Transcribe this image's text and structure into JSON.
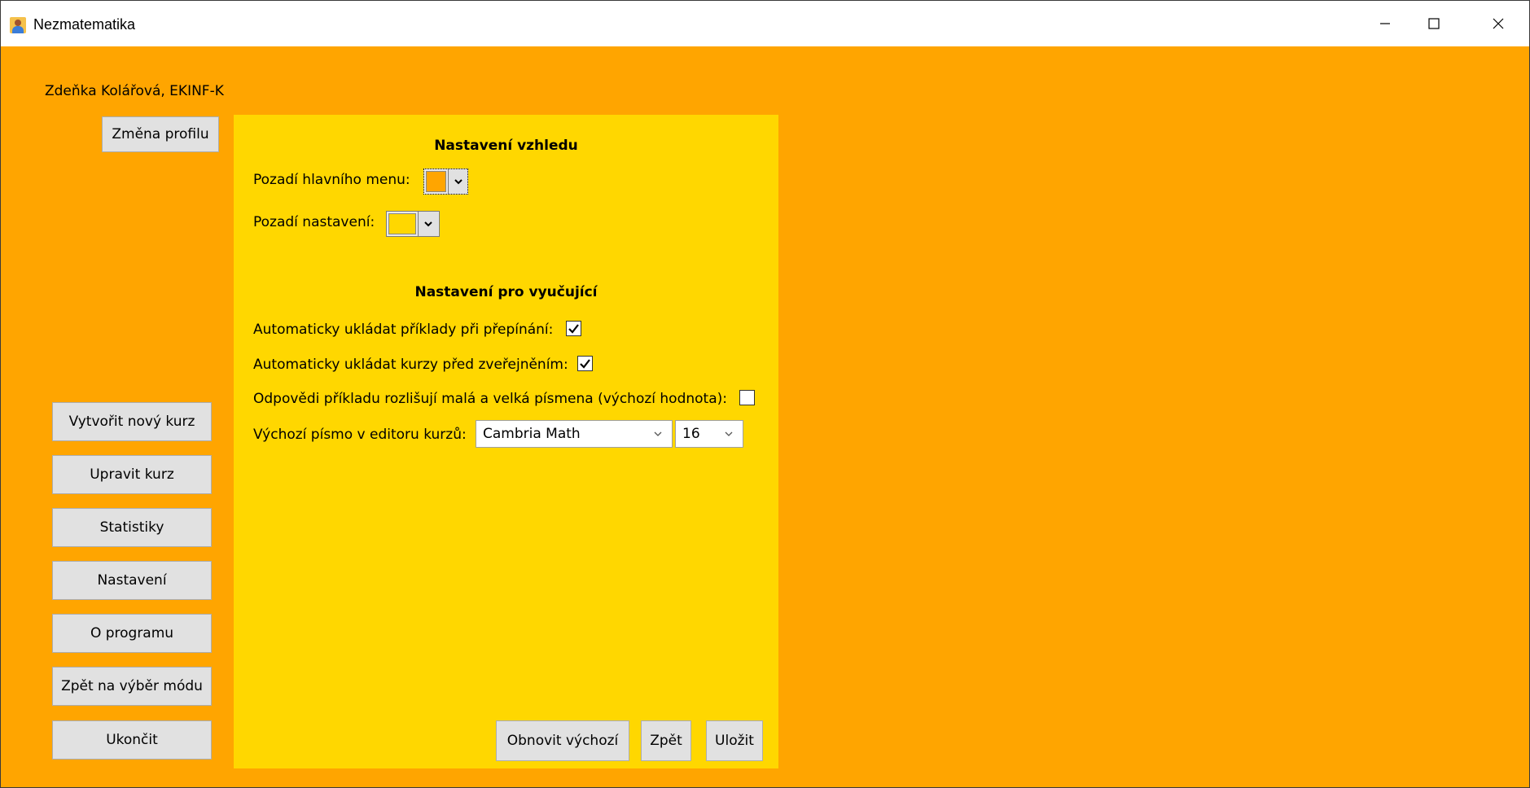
{
  "window": {
    "title": "Nezmatematika"
  },
  "user": {
    "label": "Zdeňka Kolářová, EKINF-K"
  },
  "sidebar": {
    "profile_button": "Změna profilu",
    "items": [
      {
        "label": "Vytvořit nový kurz"
      },
      {
        "label": "Upravit kurz"
      },
      {
        "label": "Statistiky"
      },
      {
        "label": "Nastavení"
      },
      {
        "label": "O programu"
      },
      {
        "label": "Zpět na výběr módu"
      },
      {
        "label": "Ukončit"
      }
    ]
  },
  "settings": {
    "appearance_heading": "Nastavení vzhledu",
    "main_menu_bg_label": "Pozadí hlavního menu:",
    "main_menu_bg_color": "#ffa500",
    "settings_bg_label": "Pozadí nastavení:",
    "settings_bg_color": "#ffd700",
    "teacher_heading": "Nastavení pro vyučující",
    "autosave_examples_label": "Automaticky ukládat příklady při přepínání:",
    "autosave_examples_checked": true,
    "autosave_courses_label": "Automaticky ukládat kurzy před zveřejněním:",
    "autosave_courses_checked": true,
    "case_sensitive_label": "Odpovědi příkladu rozlišují malá a velká písmena (výchozí hodnota):",
    "case_sensitive_checked": false,
    "default_font_label": "Výchozí písmo v editoru kurzů:",
    "font_family_value": "Cambria Math",
    "font_size_value": "16"
  },
  "footer": {
    "reset_button": "Obnovit výchozí",
    "back_button": "Zpět",
    "save_button": "Uložit"
  }
}
